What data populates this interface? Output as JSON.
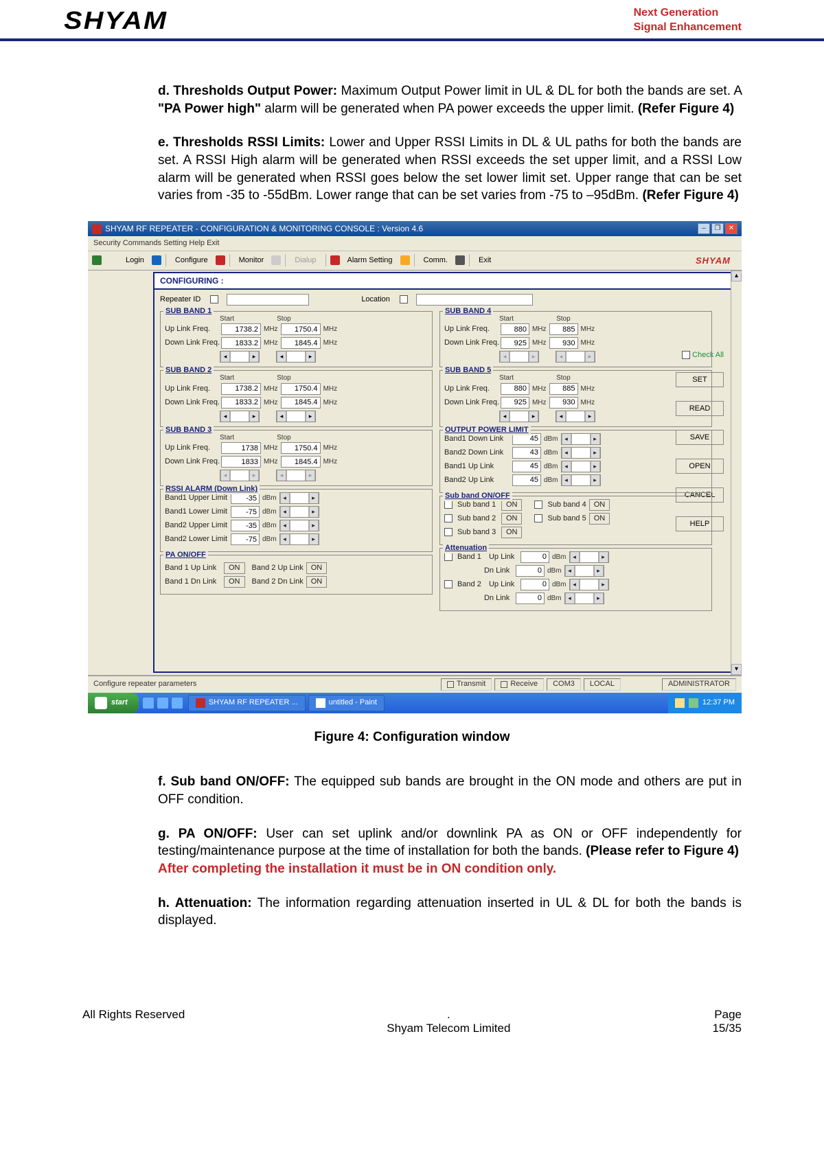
{
  "header": {
    "logo": "SHYAM",
    "tagline_l1": "Next Generation",
    "tagline_l2": "Signal Enhancement"
  },
  "paragraphs": {
    "d_lead": "d. Thresholds Output Power:",
    "d_body": " Maximum Output Power limit in UL & DL for both the bands are set. A ",
    "d_bold2": "\"PA Power high\"",
    "d_body2": " alarm will be generated when PA power exceeds the upper limit. ",
    "d_ref": "(Refer Figure 4)",
    "e_lead": "e. Thresholds RSSI Limits:",
    "e_body": " Lower and Upper RSSI Limits in DL & UL paths for both the bands are set.  A RSSI High alarm will be generated when RSSI exceeds the set upper limit, and a RSSI Low alarm will be generated when RSSI goes below the set lower limit set. Upper range that can be set varies from -35 to -55dBm. Lower range that can be set varies from -75 to –95dBm. ",
    "e_ref": "(Refer Figure 4)",
    "f_lead": "f. Sub band ON/OFF:",
    "f_body": " The equipped sub bands are brought in the ON mode and others are put in OFF condition.",
    "g_lead": "g. PA ON/OFF:",
    "g_body": " User can set uplink and/or downlink PA as ON or OFF independently for testing/maintenance purpose at the time of installation for both the bands.  ",
    "g_ref": "(Please refer to Figure 4)",
    "g_red": "After completing the installation it must be in ON condition only.",
    "h_lead": "h. Attenuation:",
    "h_body": " The information regarding attenuation inserted in UL & DL for both the bands is displayed."
  },
  "figure_caption": "Figure 4: Configuration window",
  "app": {
    "title": "SHYAM RF REPEATER - CONFIGURATION & MONITORING CONSOLE  :  Version 4.6",
    "menubar": "Security   Commands   Setting   Help   Exit",
    "toolbar": {
      "login": "Login",
      "configure": "Configure",
      "monitor": "Monitor",
      "dialup": "Dialup",
      "alarm": "Alarm Setting",
      "comm": "Comm.",
      "exit": "Exit",
      "logo": "SHYAM"
    },
    "config_hdr": "CONFIGURING :",
    "repeater_id_lbl": "Repeater ID",
    "location_lbl": "Location",
    "start_lbl": "Start",
    "stop_lbl": "Stop",
    "ulf_lbl": "Up Link Freq.",
    "dlf_lbl": "Down Link Freq.",
    "mhz": "MHz",
    "dbm": "dBm",
    "sub_bands": {
      "sb1": {
        "title": "SUB BAND 1",
        "ul_start": "1738.2",
        "ul_stop": "1750.4",
        "dl_start": "1833.2",
        "dl_stop": "1845.4"
      },
      "sb2": {
        "title": "SUB BAND 2",
        "ul_start": "1738.2",
        "ul_stop": "1750.4",
        "dl_start": "1833.2",
        "dl_stop": "1845.4"
      },
      "sb3": {
        "title": "SUB BAND 3",
        "ul_start": "1738",
        "ul_stop": "1750.4",
        "dl_start": "1833",
        "dl_stop": "1845.4"
      },
      "sb4": {
        "title": "SUB BAND 4",
        "ul_start": "880",
        "ul_stop": "885",
        "dl_start": "925",
        "dl_stop": "930"
      },
      "sb5": {
        "title": "SUB BAND 5",
        "ul_start": "880",
        "ul_stop": "885",
        "dl_start": "925",
        "dl_stop": "930"
      }
    },
    "output_power": {
      "title": "OUTPUT POWER LIMIT",
      "b1dl_lbl": "Band1 Down Link",
      "b1dl": "45",
      "b2dl_lbl": "Band2 Down Link",
      "b2dl": "43",
      "b1ul_lbl": "Band1 Up Link",
      "b1ul": "45",
      "b2ul_lbl": "Band2 Up Link",
      "b2ul": "45"
    },
    "rssi": {
      "title": "RSSI ALARM (Down Link)",
      "b1u_lbl": "Band1 Upper Limit",
      "b1u": "-35",
      "b1l_lbl": "Band1 Lower Limit",
      "b1l": "-75",
      "b2u_lbl": "Band2 Upper Limit",
      "b2u": "-35",
      "b2l_lbl": "Band2 Lower Limit",
      "b2l": "-75"
    },
    "subband_onoff": {
      "title": "Sub band ON/OFF",
      "sb1": "Sub band 1",
      "sb2": "Sub band 2",
      "sb3": "Sub band 3",
      "sb4": "Sub band 4",
      "sb5": "Sub band 5",
      "on": "ON"
    },
    "pa_onoff": {
      "title": "PA ON/OFF",
      "b1u": "Band 1 Up Link",
      "b2u": "Band 2 Up Link",
      "b1d": "Band 1 Dn Link",
      "b2d": "Band 2 Dn Link",
      "on": "ON"
    },
    "atten": {
      "title": "Attenuation",
      "b1": "Band 1",
      "b2": "Band 2",
      "ul": "Up Link",
      "dl": "Dn Link",
      "val": "0"
    },
    "side": {
      "set": "SET",
      "read": "READ",
      "save": "SAVE",
      "open": "OPEN",
      "cancel": "CANCEL",
      "help": "HELP",
      "check_all": "Check All"
    },
    "status": {
      "left": "Configure repeater parameters",
      "tx": "Transmit",
      "rx": "Receive",
      "port": "COM3",
      "mode": "LOCAL",
      "user": "ADMINISTRATOR"
    }
  },
  "taskbar": {
    "start": "start",
    "task1": "SHYAM RF REPEATER ...",
    "task2": "untitled - Paint",
    "time": "12:37 PM"
  },
  "footer": {
    "left": "All Rights Reserved",
    "dot": ".",
    "center": "Shyam Telecom Limited",
    "page_lbl": "Page",
    "page_num": "15/35"
  }
}
